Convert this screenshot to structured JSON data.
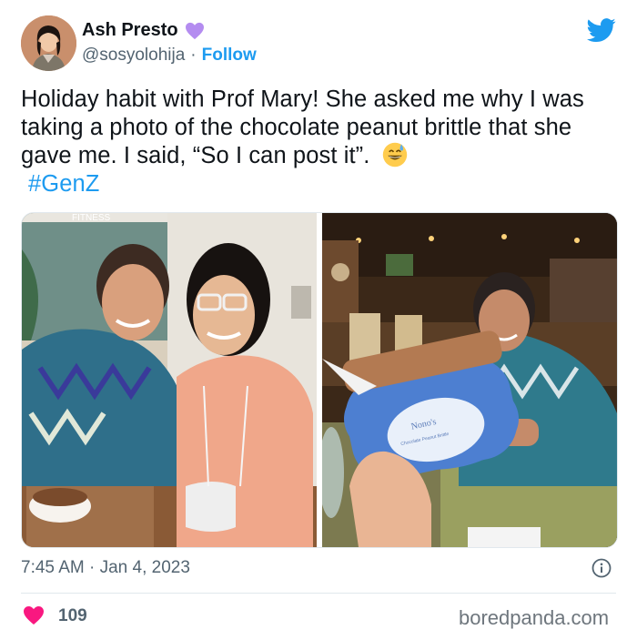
{
  "author": {
    "display_name": "Ash Presto",
    "handle": "@sosyolohija",
    "separator": "·",
    "follow_label": "Follow",
    "badge_icon": "purple-heart-icon",
    "badge_color": "#b48cf0"
  },
  "tweet": {
    "text": "Holiday habit with Prof Mary! She asked me why I was taking a photo of the chocolate peanut brittle that she gave me. I said, “So I can post it”.",
    "emoji": "grinning-face-with-sweat-icon",
    "hashtag": "#GenZ",
    "timestamp": "7:45 AM · Jan 4, 2023"
  },
  "media": {
    "left_sign_text": "FITNESS",
    "jar_label_brand": "Nono's",
    "jar_label_product": "Chocolate Peanut Brittle"
  },
  "engagement": {
    "like_icon": "heart-icon",
    "like_count": "109",
    "like_color": "#f91880"
  },
  "watermark": "boredpanda.com",
  "colors": {
    "accent": "#1d9bf0",
    "text": "#0f1419",
    "muted": "#536471"
  }
}
